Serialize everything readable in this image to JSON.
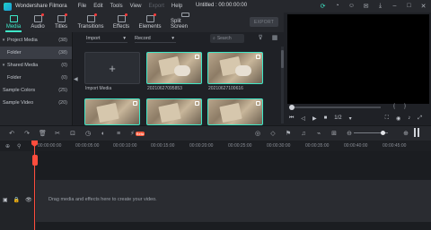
{
  "app": {
    "name": "Wondershare Filmora",
    "document_title": "Untitled : 00:00:00:00"
  },
  "menu": [
    "File",
    "Edit",
    "Tools",
    "View",
    "Export",
    "Help"
  ],
  "tabs": [
    {
      "label": "Media",
      "active": true
    },
    {
      "label": "Audio"
    },
    {
      "label": "Titles"
    },
    {
      "label": "Transitions"
    },
    {
      "label": "Effects"
    },
    {
      "label": "Elements"
    },
    {
      "label": "Split Screen"
    }
  ],
  "export_label": "EXPORT",
  "library": {
    "items": [
      {
        "label": "Project Media",
        "count": "(38)"
      },
      {
        "label": "Folder",
        "count": "(38)"
      },
      {
        "label": "Shared Media",
        "count": "(0)"
      },
      {
        "label": "Folder",
        "count": "(0)"
      },
      {
        "label": "Sample Colors",
        "count": "(25)"
      },
      {
        "label": "Sample Video",
        "count": "(20)"
      }
    ]
  },
  "browser": {
    "import_dropdown": "Import",
    "record_dropdown": "Record",
    "search_placeholder": "Search",
    "import_media_label": "Import Media",
    "clips": [
      {
        "label": "20210627095853"
      },
      {
        "label": "20210627100616"
      }
    ]
  },
  "preview": {
    "speed": "1/2",
    "page_indicator": "{   }"
  },
  "timeline": {
    "ruler_ticks": [
      "00:00:00:00",
      "00:00:05:00",
      "00:00:10:00",
      "00:00:15:00",
      "00:00:20:00",
      "00:00:25:00",
      "00:00:30:00",
      "00:00:35:00",
      "00:00:40:00",
      "00:00:45:00"
    ],
    "drag_hint": "Drag media and effects here to create your video.",
    "beta_badge": "Beta"
  },
  "colors": {
    "accent": "#3ee8c8",
    "playhead": "#ff4d3d",
    "background": "#1f2126"
  }
}
